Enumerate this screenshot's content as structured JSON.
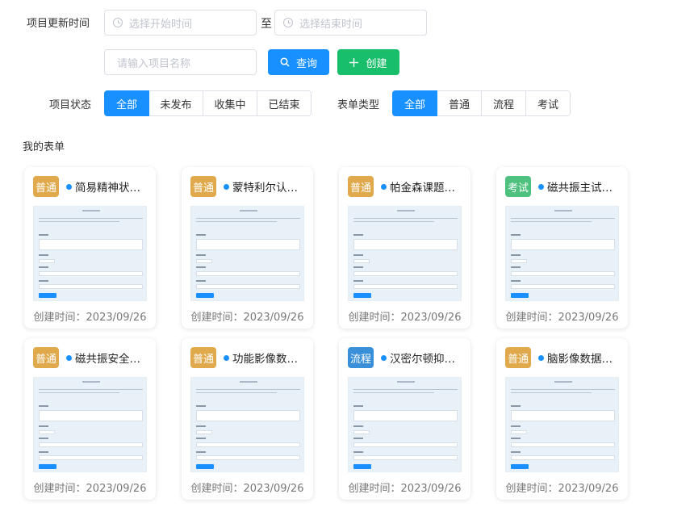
{
  "filters": {
    "update_time_label": "项目更新时间",
    "start_placeholder": "选择开始时间",
    "range_sep": "至",
    "end_placeholder": "选择结束时间",
    "name_placeholder": "请输入项目名称",
    "query_label": "查询",
    "create_label": "创建",
    "status_label": "项目状态",
    "status_options": [
      "全部",
      "未发布",
      "收集中",
      "已结束"
    ],
    "status_selected": "全部",
    "type_label": "表单类型",
    "type_options": [
      "全部",
      "普通",
      "流程",
      "考试"
    ],
    "type_selected": "全部"
  },
  "section_title": "我的表单",
  "colors": {
    "primary": "#1890ff",
    "create": "#19be6b",
    "tag_normal": "#e0a94b",
    "tag_exam": "#4fc17e",
    "tag_flow": "#3a8fd9"
  },
  "cards": [
    {
      "tag": "普通",
      "title": "简易精神状态检查量表",
      "date": "创建时间：2023/09/26"
    },
    {
      "tag": "普通",
      "title": "蒙特利尔认知评估量表",
      "date": "创建时间：2023/09/26"
    },
    {
      "tag": "普通",
      "title": "帕金森课题随访表单",
      "date": "创建时间：2023/09/26"
    },
    {
      "tag": "考试",
      "title": "磁共振主试考核测验",
      "date": "创建时间：2023/09/26"
    },
    {
      "tag": "普通",
      "title": "磁共振安全筛查表",
      "date": "创建时间：2023/09/26"
    },
    {
      "tag": "普通",
      "title": "功能影像数据采集表",
      "date": "创建时间：2023/09/26"
    },
    {
      "tag": "流程",
      "title": "汉密尔顿抑郁量表",
      "date": "创建时间：2023/09/26"
    },
    {
      "tag": "普通",
      "title": "脑影像数据登记表",
      "date": "创建时间：2023/09/26"
    }
  ]
}
